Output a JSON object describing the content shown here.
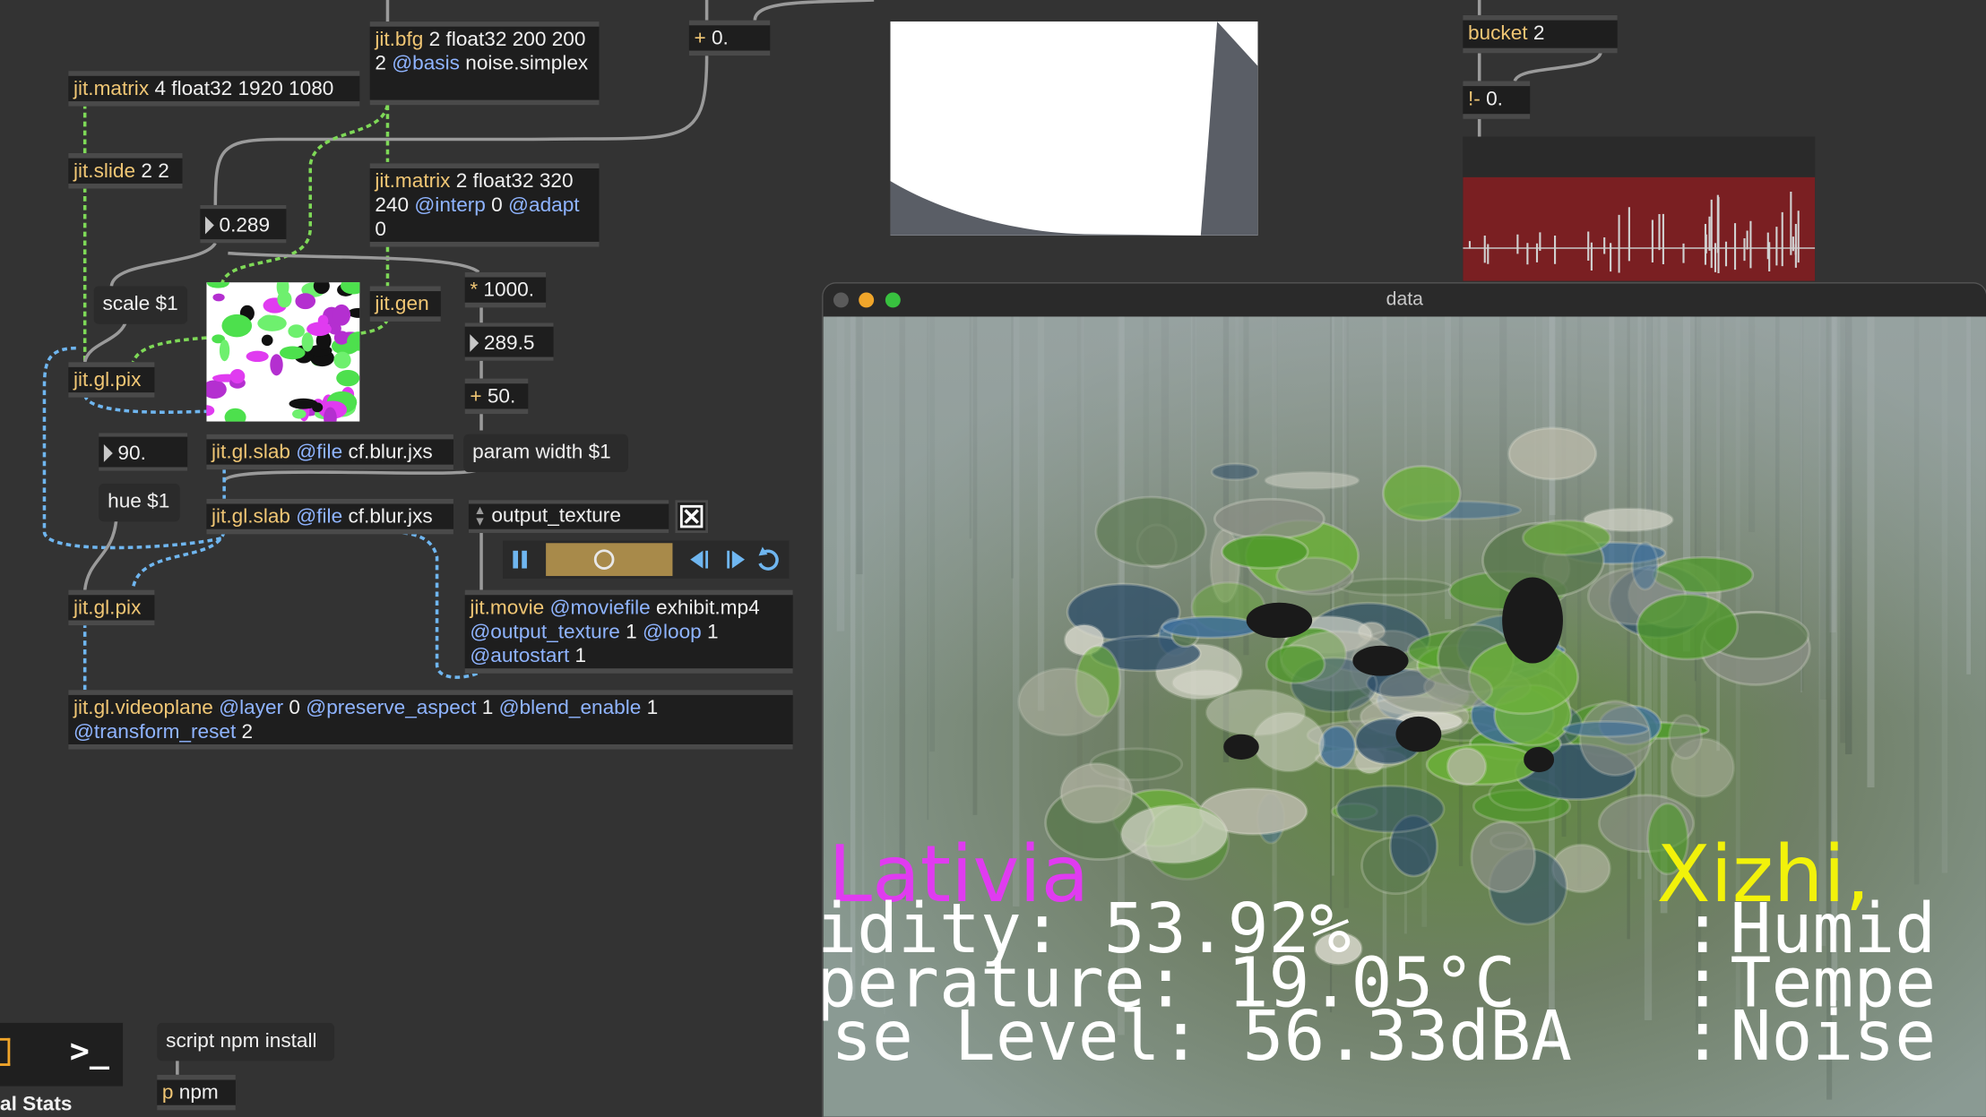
{
  "objects": {
    "jit_bfg": {
      "name": "jit.bfg",
      "args": "2 float32 200 200 2",
      "attr": "@basis",
      "val": "noise.simplex"
    },
    "plus0": {
      "name": "+",
      "args": "0."
    },
    "jit_matrix_main": {
      "name": "jit.matrix",
      "args": "4 float32 1920 1080"
    },
    "jit_slide": {
      "name": "jit.slide",
      "args": "2 2"
    },
    "jit_matrix_small": {
      "name": "jit.matrix",
      "args": "2 float32 320 240",
      "attr1": "@interp",
      "val1": "0",
      "attr2": "@adapt",
      "val2": "0"
    },
    "jit_gen": {
      "name": "jit.gen"
    },
    "mul": {
      "name": "*",
      "args": "1000."
    },
    "plus50": {
      "name": "+",
      "args": "50."
    },
    "pix1": {
      "name": "jit.gl.pix"
    },
    "pix2": {
      "name": "jit.gl.pix"
    },
    "slab1": {
      "name": "jit.gl.slab",
      "attr": "@file",
      "val": "cf.blur.jxs"
    },
    "slab2": {
      "name": "jit.gl.slab",
      "attr": "@file",
      "val": "cf.blur.jxs"
    },
    "movie": {
      "name": "jit.movie",
      "attr1": "@moviefile",
      "val1": "exhibit.mp4",
      "attr2": "@output_texture",
      "val2": "1",
      "attr3": "@loop",
      "val3": "1",
      "attr4": "@autostart",
      "val4": "1"
    },
    "videoplane": {
      "name": "jit.gl.videoplane",
      "attr1": "@layer",
      "val1": "0",
      "attr2": "@preserve_aspect",
      "val2": "1",
      "attr3": "@blend_enable",
      "val3": "1",
      "attr4": "@transform_reset",
      "val4": "2"
    },
    "bucket": {
      "name": "bucket",
      "args": "2"
    },
    "neq": {
      "name": "!-",
      "args": "0."
    },
    "pnpm": {
      "name": "p",
      "args": "npm"
    }
  },
  "numbers": {
    "n1": "0.289",
    "n2": "289.5",
    "n3": "90."
  },
  "messages": {
    "scale": "scale $1",
    "hue": "hue $1",
    "param": "param width $1",
    "npm": "script npm install"
  },
  "menu": {
    "selected": "output_texture"
  },
  "window": {
    "title": "data"
  },
  "overlay": {
    "city_left": "Lativia",
    "city_right": "Xizhi,",
    "line1": "idity: 53.92%",
    "line2": "perature: 19.05°C",
    "line3": "se Level: 56.33dBA",
    "right1": "Humid",
    "right2": "Tempe",
    "right3": "Noise",
    "colon": ":"
  },
  "sidebar": {
    "stats": "al Stats",
    "terminal": ">_"
  },
  "colors": {
    "magenta": "#e03bf0",
    "yellow": "#f2f20a",
    "cable_green": "#7ed957",
    "cable_blue": "#6fb6f0",
    "cable_gray": "#9a9a9a"
  }
}
